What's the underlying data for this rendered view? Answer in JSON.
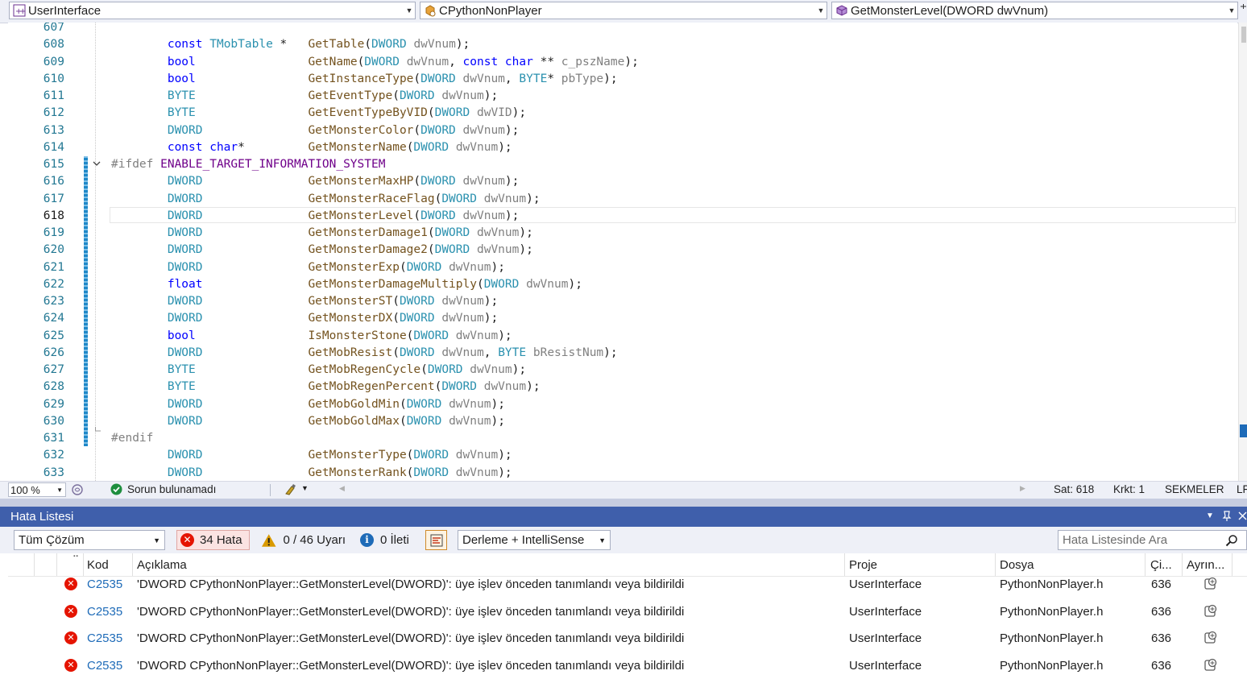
{
  "navbar": {
    "project": "UserInterface",
    "class": "CPythonNonPlayer",
    "member": "GetMonsterLevel(DWORD dwVnum)"
  },
  "editor": {
    "lines": [
      {
        "n": "607",
        "segs": []
      },
      {
        "n": "608",
        "segs": [
          [
            "ind",
            "        "
          ],
          [
            "kw",
            "const "
          ],
          [
            "ty",
            "TMobTable"
          ],
          [
            "",
            " *   "
          ],
          [
            "fn",
            "GetTable"
          ],
          [
            "",
            "("
          ],
          [
            "ty",
            "DWORD"
          ],
          [
            "",
            " "
          ],
          [
            "pr",
            "dwVnum"
          ],
          [
            "",
            ");"
          ]
        ]
      },
      {
        "n": "609",
        "segs": [
          [
            "ind",
            "        "
          ],
          [
            "kw",
            "bool"
          ],
          [
            "",
            "                "
          ],
          [
            "fn",
            "GetName"
          ],
          [
            "",
            "("
          ],
          [
            "ty",
            "DWORD"
          ],
          [
            "",
            " "
          ],
          [
            "pr",
            "dwVnum"
          ],
          [
            "",
            ", "
          ],
          [
            "kw",
            "const char"
          ],
          [
            "",
            " ** "
          ],
          [
            "pr",
            "c_pszName"
          ],
          [
            "",
            ");"
          ]
        ]
      },
      {
        "n": "610",
        "segs": [
          [
            "ind",
            "        "
          ],
          [
            "kw",
            "bool"
          ],
          [
            "",
            "                "
          ],
          [
            "fn",
            "GetInstanceType"
          ],
          [
            "",
            "("
          ],
          [
            "ty",
            "DWORD"
          ],
          [
            "",
            " "
          ],
          [
            "pr",
            "dwVnum"
          ],
          [
            "",
            ", "
          ],
          [
            "ty",
            "BYTE"
          ],
          [
            "",
            "* "
          ],
          [
            "pr",
            "pbType"
          ],
          [
            "",
            ");"
          ]
        ]
      },
      {
        "n": "611",
        "segs": [
          [
            "ind",
            "        "
          ],
          [
            "ty",
            "BYTE"
          ],
          [
            "",
            "                "
          ],
          [
            "fn",
            "GetEventType"
          ],
          [
            "",
            "("
          ],
          [
            "ty",
            "DWORD"
          ],
          [
            "",
            " "
          ],
          [
            "pr",
            "dwVnum"
          ],
          [
            "",
            ");"
          ]
        ]
      },
      {
        "n": "612",
        "segs": [
          [
            "ind",
            "        "
          ],
          [
            "ty",
            "BYTE"
          ],
          [
            "",
            "                "
          ],
          [
            "fn",
            "GetEventTypeByVID"
          ],
          [
            "",
            "("
          ],
          [
            "ty",
            "DWORD"
          ],
          [
            "",
            " "
          ],
          [
            "pr",
            "dwVID"
          ],
          [
            "",
            ");"
          ]
        ]
      },
      {
        "n": "613",
        "segs": [
          [
            "ind",
            "        "
          ],
          [
            "ty",
            "DWORD"
          ],
          [
            "",
            "               "
          ],
          [
            "fn",
            "GetMonsterColor"
          ],
          [
            "",
            "("
          ],
          [
            "ty",
            "DWORD"
          ],
          [
            "",
            " "
          ],
          [
            "pr",
            "dwVnum"
          ],
          [
            "",
            ");"
          ]
        ]
      },
      {
        "n": "614",
        "segs": [
          [
            "ind",
            "        "
          ],
          [
            "kw",
            "const char"
          ],
          [
            "",
            "*         "
          ],
          [
            "fn",
            "GetMonsterName"
          ],
          [
            "",
            "("
          ],
          [
            "ty",
            "DWORD"
          ],
          [
            "",
            " "
          ],
          [
            "pr",
            "dwVnum"
          ],
          [
            "",
            ");"
          ]
        ]
      },
      {
        "n": "615",
        "segs": [
          [
            "pp",
            "#ifdef "
          ],
          [
            "mc",
            "ENABLE_TARGET_INFORMATION_SYSTEM"
          ]
        ]
      },
      {
        "n": "616",
        "segs": [
          [
            "ind",
            "        "
          ],
          [
            "ty",
            "DWORD"
          ],
          [
            "",
            "               "
          ],
          [
            "fn",
            "GetMonsterMaxHP"
          ],
          [
            "",
            "("
          ],
          [
            "ty",
            "DWORD"
          ],
          [
            "",
            " "
          ],
          [
            "pr",
            "dwVnum"
          ],
          [
            "",
            ");"
          ]
        ]
      },
      {
        "n": "617",
        "segs": [
          [
            "ind",
            "        "
          ],
          [
            "ty",
            "DWORD"
          ],
          [
            "",
            "               "
          ],
          [
            "fn",
            "GetMonsterRaceFlag"
          ],
          [
            "",
            "("
          ],
          [
            "ty",
            "DWORD"
          ],
          [
            "",
            " "
          ],
          [
            "pr",
            "dwVnum"
          ],
          [
            "",
            ");"
          ]
        ]
      },
      {
        "n": "618",
        "segs": [
          [
            "ind",
            "        "
          ],
          [
            "ty",
            "DWORD"
          ],
          [
            "",
            "               "
          ],
          [
            "fn",
            "GetMonsterLevel"
          ],
          [
            "",
            "("
          ],
          [
            "ty",
            "DWORD"
          ],
          [
            "",
            " "
          ],
          [
            "pr",
            "dwVnum"
          ],
          [
            "",
            ");"
          ]
        ]
      },
      {
        "n": "619",
        "segs": [
          [
            "ind",
            "        "
          ],
          [
            "ty",
            "DWORD"
          ],
          [
            "",
            "               "
          ],
          [
            "fn",
            "GetMonsterDamage1"
          ],
          [
            "",
            "("
          ],
          [
            "ty",
            "DWORD"
          ],
          [
            "",
            " "
          ],
          [
            "pr",
            "dwVnum"
          ],
          [
            "",
            ");"
          ]
        ]
      },
      {
        "n": "620",
        "segs": [
          [
            "ind",
            "        "
          ],
          [
            "ty",
            "DWORD"
          ],
          [
            "",
            "               "
          ],
          [
            "fn",
            "GetMonsterDamage2"
          ],
          [
            "",
            "("
          ],
          [
            "ty",
            "DWORD"
          ],
          [
            "",
            " "
          ],
          [
            "pr",
            "dwVnum"
          ],
          [
            "",
            ");"
          ]
        ]
      },
      {
        "n": "621",
        "segs": [
          [
            "ind",
            "        "
          ],
          [
            "ty",
            "DWORD"
          ],
          [
            "",
            "               "
          ],
          [
            "fn",
            "GetMonsterExp"
          ],
          [
            "",
            "("
          ],
          [
            "ty",
            "DWORD"
          ],
          [
            "",
            " "
          ],
          [
            "pr",
            "dwVnum"
          ],
          [
            "",
            ");"
          ]
        ]
      },
      {
        "n": "622",
        "segs": [
          [
            "ind",
            "        "
          ],
          [
            "kw",
            "float"
          ],
          [
            "",
            "               "
          ],
          [
            "fn",
            "GetMonsterDamageMultiply"
          ],
          [
            "",
            "("
          ],
          [
            "ty",
            "DWORD"
          ],
          [
            "",
            " "
          ],
          [
            "pr",
            "dwVnum"
          ],
          [
            "",
            ");"
          ]
        ]
      },
      {
        "n": "623",
        "segs": [
          [
            "ind",
            "        "
          ],
          [
            "ty",
            "DWORD"
          ],
          [
            "",
            "               "
          ],
          [
            "fn",
            "GetMonsterST"
          ],
          [
            "",
            "("
          ],
          [
            "ty",
            "DWORD"
          ],
          [
            "",
            " "
          ],
          [
            "pr",
            "dwVnum"
          ],
          [
            "",
            ");"
          ]
        ]
      },
      {
        "n": "624",
        "segs": [
          [
            "ind",
            "        "
          ],
          [
            "ty",
            "DWORD"
          ],
          [
            "",
            "               "
          ],
          [
            "fn",
            "GetMonsterDX"
          ],
          [
            "",
            "("
          ],
          [
            "ty",
            "DWORD"
          ],
          [
            "",
            " "
          ],
          [
            "pr",
            "dwVnum"
          ],
          [
            "",
            ");"
          ]
        ]
      },
      {
        "n": "625",
        "segs": [
          [
            "ind",
            "        "
          ],
          [
            "kw",
            "bool"
          ],
          [
            "",
            "                "
          ],
          [
            "fn",
            "IsMonsterStone"
          ],
          [
            "",
            "("
          ],
          [
            "ty",
            "DWORD"
          ],
          [
            "",
            " "
          ],
          [
            "pr",
            "dwVnum"
          ],
          [
            "",
            ");"
          ]
        ]
      },
      {
        "n": "626",
        "segs": [
          [
            "ind",
            "        "
          ],
          [
            "ty",
            "DWORD"
          ],
          [
            "",
            "               "
          ],
          [
            "fn",
            "GetMobResist"
          ],
          [
            "",
            "("
          ],
          [
            "ty",
            "DWORD"
          ],
          [
            "",
            " "
          ],
          [
            "pr",
            "dwVnum"
          ],
          [
            "",
            ", "
          ],
          [
            "ty",
            "BYTE"
          ],
          [
            "",
            " "
          ],
          [
            "pr",
            "bResistNum"
          ],
          [
            "",
            ");"
          ]
        ]
      },
      {
        "n": "627",
        "segs": [
          [
            "ind",
            "        "
          ],
          [
            "ty",
            "BYTE"
          ],
          [
            "",
            "                "
          ],
          [
            "fn",
            "GetMobRegenCycle"
          ],
          [
            "",
            "("
          ],
          [
            "ty",
            "DWORD"
          ],
          [
            "",
            " "
          ],
          [
            "pr",
            "dwVnum"
          ],
          [
            "",
            ");"
          ]
        ]
      },
      {
        "n": "628",
        "segs": [
          [
            "ind",
            "        "
          ],
          [
            "ty",
            "BYTE"
          ],
          [
            "",
            "                "
          ],
          [
            "fn",
            "GetMobRegenPercent"
          ],
          [
            "",
            "("
          ],
          [
            "ty",
            "DWORD"
          ],
          [
            "",
            " "
          ],
          [
            "pr",
            "dwVnum"
          ],
          [
            "",
            ");"
          ]
        ]
      },
      {
        "n": "629",
        "segs": [
          [
            "ind",
            "        "
          ],
          [
            "ty",
            "DWORD"
          ],
          [
            "",
            "               "
          ],
          [
            "fn",
            "GetMobGoldMin"
          ],
          [
            "",
            "("
          ],
          [
            "ty",
            "DWORD"
          ],
          [
            "",
            " "
          ],
          [
            "pr",
            "dwVnum"
          ],
          [
            "",
            ");"
          ]
        ]
      },
      {
        "n": "630",
        "segs": [
          [
            "ind",
            "        "
          ],
          [
            "ty",
            "DWORD"
          ],
          [
            "",
            "               "
          ],
          [
            "fn",
            "GetMobGoldMax"
          ],
          [
            "",
            "("
          ],
          [
            "ty",
            "DWORD"
          ],
          [
            "",
            " "
          ],
          [
            "pr",
            "dwVnum"
          ],
          [
            "",
            ");"
          ]
        ]
      },
      {
        "n": "631",
        "segs": [
          [
            "pp",
            "#endif"
          ]
        ]
      },
      {
        "n": "632",
        "segs": [
          [
            "ind",
            "        "
          ],
          [
            "ty",
            "DWORD"
          ],
          [
            "",
            "               "
          ],
          [
            "fn",
            "GetMonsterType"
          ],
          [
            "",
            "("
          ],
          [
            "ty",
            "DWORD"
          ],
          [
            "",
            " "
          ],
          [
            "pr",
            "dwVnum"
          ],
          [
            "",
            ");"
          ]
        ]
      },
      {
        "n": "633",
        "segs": [
          [
            "ind",
            "        "
          ],
          [
            "ty",
            "DWORD"
          ],
          [
            "",
            "               "
          ],
          [
            "fn",
            "GetMonsterRank"
          ],
          [
            "",
            "("
          ],
          [
            "ty",
            "DWORD"
          ],
          [
            "",
            " "
          ],
          [
            "pr",
            "dwVnum"
          ],
          [
            "",
            ");"
          ]
        ]
      }
    ],
    "current_line": "618"
  },
  "status": {
    "zoom": "100 %",
    "issues": "Sorun bulunamadı",
    "line": "Sat: 618",
    "col": "Krkt: 1",
    "tabs": "SEKMELER",
    "eol": "LF"
  },
  "errorlist": {
    "title": "Hata Listesi",
    "scope": "Tüm Çözüm",
    "errors": "34 Hata",
    "warnings": "0 / 46 Uyarı",
    "messages": "0 İleti",
    "build_filter": "Derleme + IntelliSense",
    "search_placeholder": "Hata Listesinde Ara",
    "columns": {
      "code": "Kod",
      "desc": "Açıklama",
      "project": "Proje",
      "file": "Dosya",
      "line": "Çi...",
      "suppress": "Ayrın..."
    },
    "rows": [
      {
        "code": "C2535",
        "desc": "'DWORD CPythonNonPlayer::GetMonsterLevel(DWORD)': üye işlev önceden tanımlandı veya bildirildi",
        "project": "UserInterface",
        "file": "PythonNonPlayer.h",
        "line": "636"
      },
      {
        "code": "C2535",
        "desc": "'DWORD CPythonNonPlayer::GetMonsterLevel(DWORD)': üye işlev önceden tanımlandı veya bildirildi",
        "project": "UserInterface",
        "file": "PythonNonPlayer.h",
        "line": "636"
      },
      {
        "code": "C2535",
        "desc": "'DWORD CPythonNonPlayer::GetMonsterLevel(DWORD)': üye işlev önceden tanımlandı veya bildirildi",
        "project": "UserInterface",
        "file": "PythonNonPlayer.h",
        "line": "636"
      },
      {
        "code": "C2535",
        "desc": "'DWORD CPythonNonPlayer::GetMonsterLevel(DWORD)': üye işlev önceden tanımlandı veya bildirildi",
        "project": "UserInterface",
        "file": "PythonNonPlayer.h",
        "line": "636"
      }
    ]
  },
  "colors": {
    "accent": "#3f5fab",
    "error": "#e51400",
    "warning": "#d99a00",
    "info": "#1e6bb8"
  }
}
